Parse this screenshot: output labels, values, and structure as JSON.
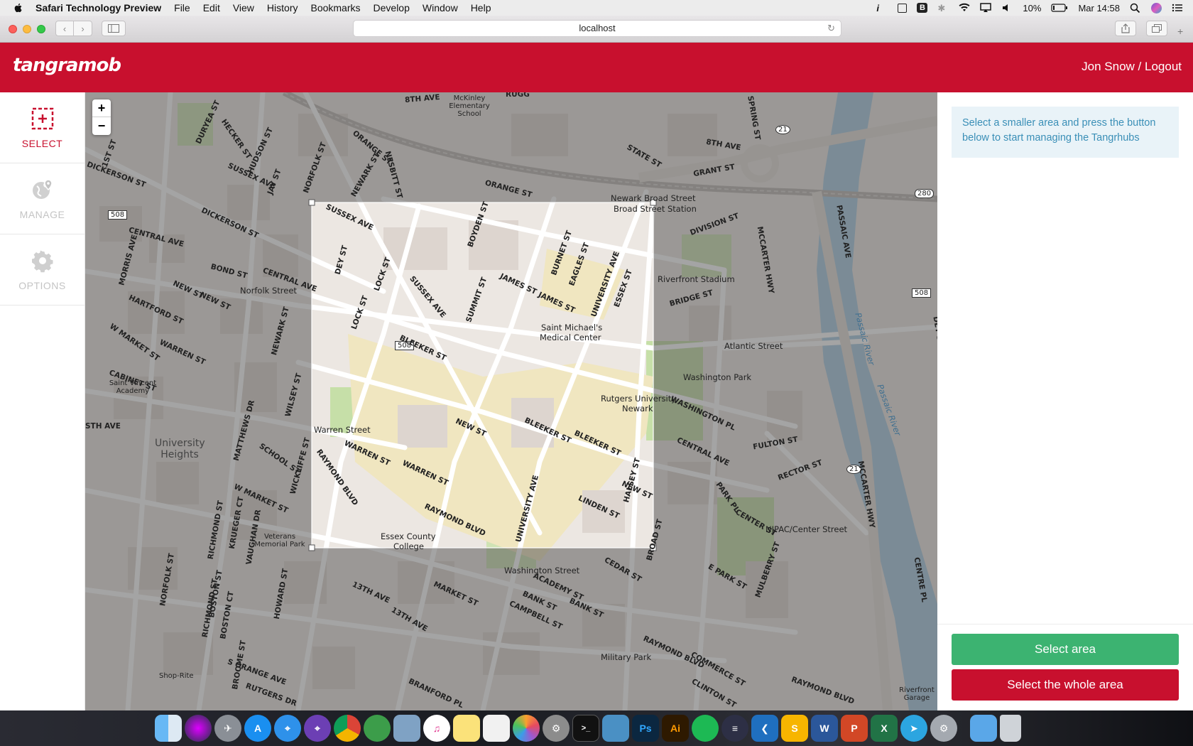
{
  "menubar": {
    "app_name": "Safari Technology Preview",
    "items": [
      "File",
      "Edit",
      "View",
      "History",
      "Bookmarks",
      "Develop",
      "Window",
      "Help"
    ],
    "battery": "10%",
    "clock": "Mar 14:58"
  },
  "browser": {
    "url": "localhost"
  },
  "header": {
    "logo": "tangramob",
    "user_link": "Jon Snow / Logout",
    "brand_color": "#c8102e"
  },
  "nav": {
    "select_label": "SELECT",
    "manage_label": "MANAGE",
    "options_label": "OPTIONS"
  },
  "map": {
    "zoom_in": "+",
    "zoom_out": "−",
    "labels": [
      "8TH AVE",
      "McKinley Elementary School",
      "RUGG",
      "ORANGE ST",
      "NEWARK ST",
      "NESBITT ST",
      "STATE ST",
      "GRANT ST",
      "8TH AVE",
      "SPRING ST",
      "Newark Broad Street",
      "Broad Street Station",
      "ORANGE ST",
      "SUSSEX AVE",
      "DICKERSON ST",
      "HUDSON ST",
      "1ST ST",
      "DURYEA ST",
      "HECKER ST",
      "SUSSEX AVE",
      "JAY ST",
      "NORFOLK ST",
      "DICKERSON ST",
      "DEY ST",
      "LOCK ST",
      "BOYDEN ST",
      "BURNET ST",
      "EAGLES ST",
      "DIVISION ST",
      "MCCARTER HWY",
      "PASSAIC AVE",
      "Riverfront Stadium",
      "CENTRAL AVE",
      "MORRIS AVE",
      "BOND ST",
      "CENTRAL AVE",
      "Norfolk Street",
      "SUSSEX AVE",
      "SUMMIT ST",
      "JAMES ST",
      "JAMES ST",
      "UNIVERSITY AVE",
      "ESSEX ST",
      "BRIDGE ST",
      "HARTFORD ST",
      "NEW ST",
      "NEW ST",
      "LOCK ST",
      "Saint Michael's",
      "Medical Center",
      "Atlantic Street",
      "Washington Park",
      "W MARKET ST",
      "WARREN ST",
      "BLEEKER ST",
      "Rutgers University",
      "Newark",
      "Saint Vincent Academy",
      "CABINET ST",
      "Warren Street",
      "NEW ST",
      "BLEEKER ST",
      "BLEEKER ST",
      "WASHINGTON PL",
      "University Heights",
      "WARREN ST",
      "WARREN ST",
      "CENTRAL AVE",
      "FULTON ST",
      "RECTOR ST",
      "SCHOOL ST",
      "RAYMOND BLVD",
      "HALSEY ST",
      "NEW ST",
      "PARK PL",
      "CENTER ST",
      "NJPAC/Center Street",
      "W MARKET ST",
      "UNIVERSITY AVE",
      "LINDEN ST",
      "RAYMOND BLVD",
      "Veterans Memorial Park",
      "Essex County",
      "College",
      "Washington Street",
      "BROAD ST",
      "CEDAR ST",
      "E PARK ST",
      "MULBERRY ST",
      "ACADEMY ST",
      "BANK ST",
      "BANK ST",
      "CAMPBELL ST",
      "13TH AVE",
      "13TH AVE",
      "MARKET ST",
      "Military Park",
      "RAYMOND BLVD",
      "COMMERCE ST",
      "S ORANGE AVE",
      "Shop-Rite",
      "RUTGERS DR",
      "BRANFORD PL",
      "CLINTON ST",
      "RAYMOND BLVD",
      "Riverfront Garage",
      "Passaic River",
      "Passaic River",
      "MCCARTER HWY",
      "CENTRE PL",
      "DEY ST",
      "RICHMOND ST",
      "BOSTON ST",
      "NORFOLK ST",
      "HOWARD ST",
      "MATTHEWS DR",
      "WICKLIFFE ST",
      "RICHMOND ST",
      "BOSTON CT",
      "KRUEGER CT",
      "VAUGHAN DR",
      "WILSEY ST",
      "NEWARK ST",
      "BROOME ST",
      "STH AVE"
    ],
    "route_shields": [
      "508",
      "508",
      "508",
      "21",
      "21",
      "280"
    ]
  },
  "panel": {
    "info_text": "Select a smaller area and press the button below to start managing the Tangrhubs",
    "select_area_button": "Select area",
    "select_whole_button": "Select the whole area"
  },
  "dock": {
    "apps": [
      "Finder",
      "Siri",
      "Launchpad",
      "App Store",
      "Safari",
      "Safari Technology Preview",
      "Chrome",
      "Maps",
      "Preview",
      "iTunes",
      "Notes",
      "TextEdit",
      "Photos",
      "System Preferences",
      "Terminal",
      "Keynote",
      "Ps",
      "Ai",
      "Spotify",
      "Sublime",
      "VS Code",
      "Sketch",
      "Word",
      "PowerPoint",
      "Excel",
      "Telegram",
      "Settings",
      "Folder",
      "Trash"
    ]
  }
}
